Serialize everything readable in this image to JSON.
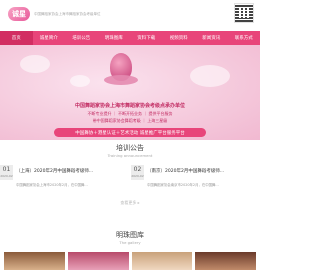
{
  "header": {
    "logo_text": "诚星",
    "tagline": "中国舞蹈家协会上海市舞蹈家协会考级单位"
  },
  "nav": {
    "items": [
      {
        "label": "首页",
        "active": true
      },
      {
        "label": "诚星简介",
        "active": false
      },
      {
        "label": "培训公告",
        "active": false
      },
      {
        "label": "明珠图库",
        "active": false
      },
      {
        "label": "资料下载",
        "active": false
      },
      {
        "label": "视频资料",
        "active": false
      },
      {
        "label": "新闻资讯",
        "active": false
      },
      {
        "label": "联系方式",
        "active": false
      }
    ]
  },
  "banner": {
    "line1": "中国舞蹈家协会上海市舞蹈家协会考级点承办单位",
    "line2": "不断专业提升 ｜ 不断开拓业务 ｜ 提供平台服务",
    "line3": "带中国舞蹈家协会舞蹈考级 ｜ 上海三星级",
    "pill": "中国舞协＋港星认证＋艺术活动 诚星推广平台服务平台"
  },
  "training": {
    "title": "培训公告",
    "subtitle": "Training announcement",
    "items": [
      {
        "day": "01",
        "ym": "2020-02",
        "title": "（上海）2020年2月中国舞蹈考级师...",
        "desc": "中国舞蹈家协会上海市2020年2月，在中国舞..."
      },
      {
        "day": "02",
        "ym": "2020-02",
        "title": "（南京）2020年2月中国舞蹈考级师...",
        "desc": "中国舞蹈家协会南京市2020年2月，在中国舞..."
      }
    ],
    "more": "查看更多 ▸"
  },
  "gallery": {
    "title": "明珠图库",
    "subtitle": "The gallery"
  },
  "colors": {
    "accent": "#e8457a",
    "accent_dark": "#d22e62"
  }
}
